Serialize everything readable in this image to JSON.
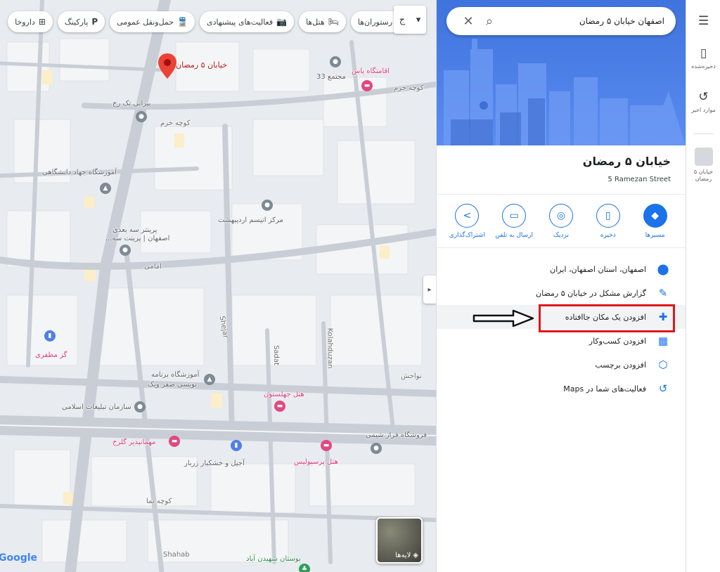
{
  "chips": [
    {
      "name": "restaurants",
      "label": "رستوران‌ها",
      "icon": "🍴"
    },
    {
      "name": "hotels",
      "label": "هتل‌ها",
      "icon": "🛏"
    },
    {
      "name": "things-to-do",
      "label": "فعالیت‌های پیشنهادی",
      "icon": "📷"
    },
    {
      "name": "transit",
      "label": "حمل‌ونقل عمومی",
      "icon": "🚆"
    },
    {
      "name": "parking",
      "label": "پارکینگ",
      "icon": "P"
    },
    {
      "name": "pharmacies",
      "label": "داروخا",
      "icon": "⊞"
    }
  ],
  "chip_more": {
    "icon": "ج",
    "caret": "▾"
  },
  "map": {
    "pin_label": "خیابان ۵ رمضان",
    "labels": [
      {
        "text": "اقامتگاه یاس",
        "cls": "pink"
      },
      {
        "text": "مجتمع 33",
        "cls": ""
      },
      {
        "text": "کوچه خرم",
        "cls": "street"
      },
      {
        "text": "بیرانی تک رخ",
        "cls": ""
      },
      {
        "text": "آموزشگاه جهاد دانشگاهی",
        "cls": ""
      },
      {
        "text": "مرکز اتیسم اردیبهشت",
        "cls": ""
      },
      {
        "text": "پرینتر سه بعدی",
        "cls": ""
      },
      {
        "text": "اصفهان | پرینت سه...",
        "cls": ""
      },
      {
        "text": "امامی",
        "cls": "street"
      },
      {
        "text": "گز مظفری",
        "cls": "pink"
      },
      {
        "text": "آموزشگاه برنامه",
        "cls": ""
      },
      {
        "text": "نویسی صفر ویک",
        "cls": ""
      },
      {
        "text": "هتل جهلستون",
        "cls": "pink"
      },
      {
        "text": "نواحش",
        "cls": "street"
      },
      {
        "text": "سازمان تبلیغات اسلامی",
        "cls": ""
      },
      {
        "text": "مهمانپذیر گلرخ",
        "cls": "pink"
      },
      {
        "text": "فروشگاه فراز شیمی",
        "cls": ""
      },
      {
        "text": "آجیل و خشکبار زربار",
        "cls": ""
      },
      {
        "text": "هتل پرسپولیس",
        "cls": "pink"
      },
      {
        "text": "بوستان شهیدن آباد",
        "cls": "green"
      },
      {
        "text": "Shahab",
        "cls": "street"
      },
      {
        "text": "Sadat",
        "cls": "street"
      },
      {
        "text": "Kolahduzan",
        "cls": "street"
      },
      {
        "text": "Shejar",
        "cls": "street"
      },
      {
        "text": "کوچه خرم",
        "cls": "street"
      },
      {
        "text": "کوچه نما",
        "cls": "street"
      }
    ],
    "layers_label": "لایه‌ها",
    "google_logo": "Google"
  },
  "search": {
    "value": "اصفهان خیابان ۵ رمضان"
  },
  "place": {
    "title": "خیابان ۵ رمضان",
    "subtitle": "5 Ramezan Street"
  },
  "actions": [
    {
      "name": "directions",
      "label": "مسیرها",
      "icon": "◆",
      "filled": true
    },
    {
      "name": "save",
      "label": "ذخیره",
      "icon": "▯"
    },
    {
      "name": "nearby",
      "label": "نزدیک",
      "icon": "◎"
    },
    {
      "name": "send-to-phone",
      "label": "ارسال به تلفن",
      "icon": "▭"
    },
    {
      "name": "share",
      "label": "اشتراک‌گذاری",
      "icon": "<"
    }
  ],
  "info": [
    {
      "name": "address",
      "text": "اصفهان، استان اصفهان، ایران",
      "icon": "⬤"
    },
    {
      "name": "report-problem",
      "text": "گزارش مشکل در خیابان ۵ رمضان",
      "icon": "✎"
    },
    {
      "name": "add-missing-place",
      "text": "افزودن یک مکان جاافتاده",
      "icon": "✚"
    },
    {
      "name": "add-business",
      "text": "افزودن کسب‌وکار",
      "icon": "▦"
    },
    {
      "name": "add-label",
      "text": "افزودن برچسب",
      "icon": "⬡"
    },
    {
      "name": "maps-activity",
      "text": "فعالیت‌های شما در Maps",
      "icon": "↺"
    }
  ],
  "rail": {
    "menu_icon": "☰",
    "saved_label": "ذخیره‌شده",
    "recent_label": "موارد اخیر",
    "current_label_1": "خیابان ۵",
    "current_label_2": "رمضان"
  },
  "colors": {
    "accent": "#1a73e8",
    "annotation": "#e0161b",
    "hero": "#3f73dd"
  }
}
